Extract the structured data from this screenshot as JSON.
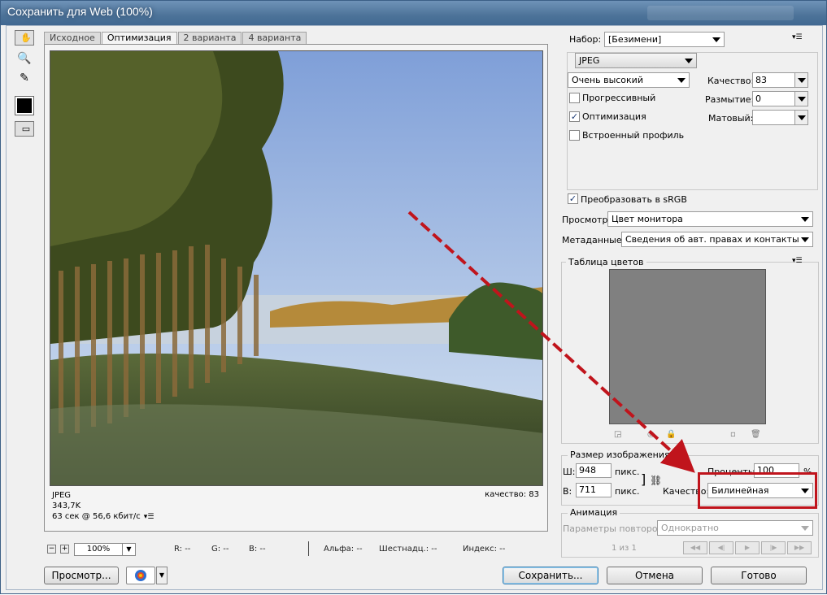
{
  "window": {
    "title": "Сохранить для Web (100%)"
  },
  "tabs": [
    "Исходное",
    "Оптимизация",
    "2 варианта",
    "4 варианта"
  ],
  "image_info": {
    "format": "JPEG",
    "size": "343,7K",
    "time": "63 сек @ 56,6 кбит/с",
    "quality": "качество: 83"
  },
  "statusbar": {
    "zoom": "100%",
    "r": "R: --",
    "g": "G: --",
    "b": "B: --",
    "alpha": "Альфа: --",
    "hex": "Шестнадц.: --",
    "index": "Индекс: --"
  },
  "buttons": {
    "preview": "Просмотр...",
    "save": "Сохранить...",
    "cancel": "Отмена",
    "done": "Готово"
  },
  "settings": {
    "preset_label": "Набор:",
    "preset_value": "[Безимени]",
    "format": "JPEG",
    "quality_preset": "Очень высокий",
    "quality_label": "Качество:",
    "quality_value": "83",
    "blur_label": "Размытие:",
    "blur_value": "0",
    "matte_label": "Матовый:",
    "matte_value": "",
    "progressive": "Прогрессивный",
    "optimized": "Оптимизация",
    "embed_profile": "Встроенный профиль",
    "convert_srgb": "Преобразовать в sRGB",
    "preview_label": "Просмотр:",
    "preview_value": "Цвет монитора",
    "metadata_label": "Метаданные:",
    "metadata_value": "Сведения об авт. правах и контакты"
  },
  "checks": {
    "progressive": false,
    "optimized": true,
    "embed_profile": false,
    "convert_srgb": true
  },
  "color_table": {
    "title": "Таблица цветов"
  },
  "image_size": {
    "title": "Размер изображения",
    "w_label": "Ш:",
    "w_value": "948",
    "w_unit": "пикс.",
    "h_label": "В:",
    "h_value": "711",
    "h_unit": "пикс.",
    "percent_label": "Проценты:",
    "percent_value": "100",
    "percent_unit": "%",
    "quality_label": "Качество:",
    "quality_value": "Билинейная"
  },
  "animation": {
    "title": "Анимация",
    "loop_label": "Параметры повторов:",
    "loop_value": "Однократно",
    "frame_counter": "1 из 1"
  },
  "colors": {
    "highlight_box": "#c0141c",
    "arrow": "#c0141c"
  }
}
